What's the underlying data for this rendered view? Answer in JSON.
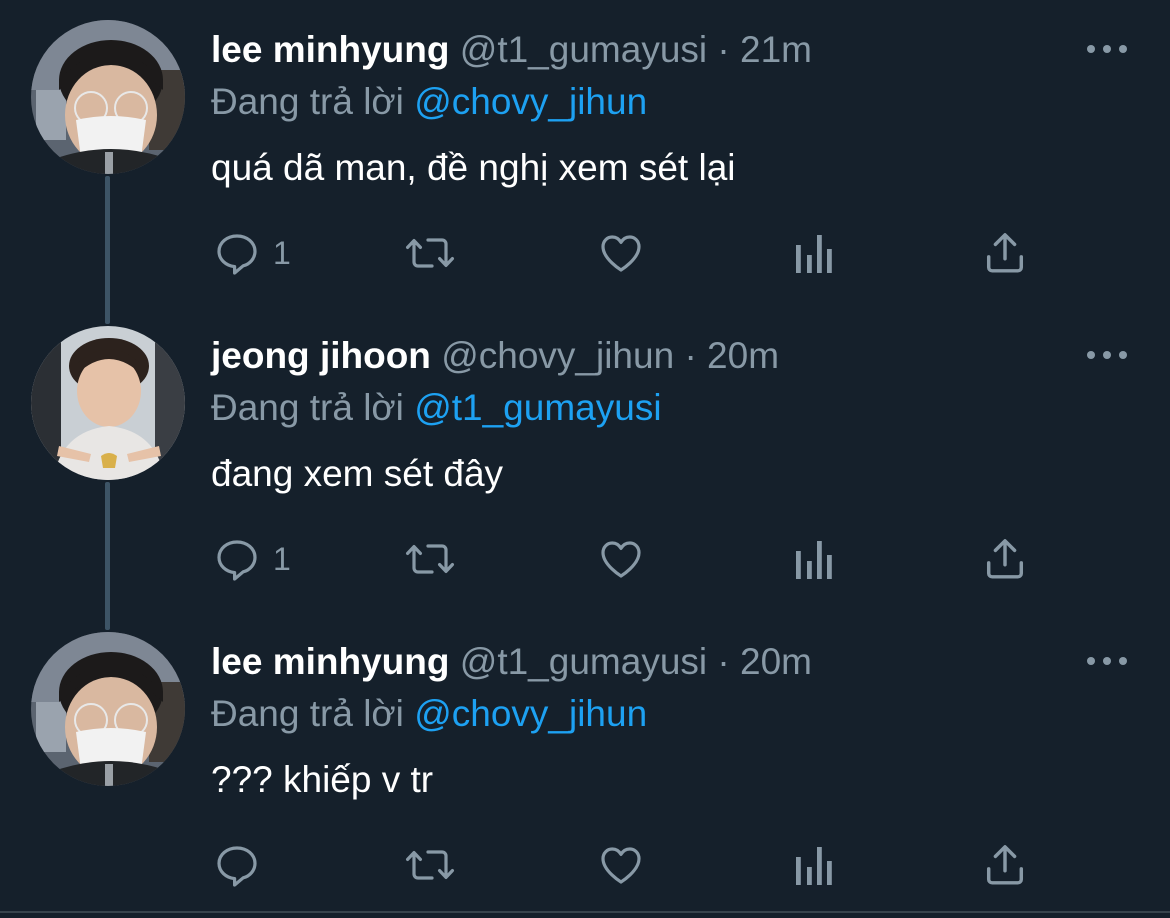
{
  "thread": {
    "tweets": [
      {
        "name": "lee minhyung",
        "handle": "@t1_gumayusi",
        "separator": "·",
        "time": "21m",
        "replying_prefix": "Đang trả lời",
        "replying_to": "@chovy_jihun",
        "text": "quá dã man, đề nghị xem sét lại",
        "reply_count": "1",
        "avatar": "gumayusi-masked-glasses-photo"
      },
      {
        "name": "jeong jihoon",
        "handle": "@chovy_jihun",
        "separator": "·",
        "time": "20m",
        "replying_prefix": "Đang trả lời",
        "replying_to": "@t1_gumayusi",
        "text": "đang xem sét đây",
        "reply_count": "1",
        "avatar": "chovy-pointing-photo"
      },
      {
        "name": "lee minhyung",
        "handle": "@t1_gumayusi",
        "separator": "·",
        "time": "20m",
        "replying_prefix": "Đang trả lời",
        "replying_to": "@chovy_jihun",
        "text": "??? khiếp v tr",
        "reply_count": "",
        "avatar": "gumayusi-masked-glasses-photo"
      }
    ]
  },
  "icons": {
    "reply": "reply-icon",
    "retweet": "retweet-icon",
    "like": "like-icon",
    "analytics": "analytics-icon",
    "share": "share-icon",
    "more": "more-icon"
  },
  "colors": {
    "background": "#15202b",
    "text_primary": "#ffffff",
    "text_secondary": "#8899a6",
    "mention": "#1da1f2",
    "thread_line": "#3d5466"
  }
}
